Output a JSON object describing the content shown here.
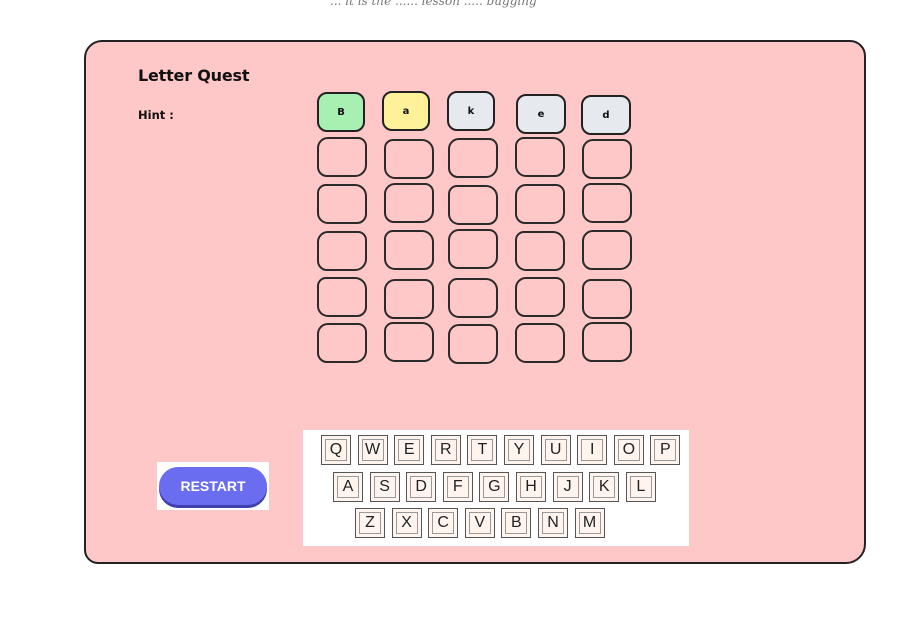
{
  "header": {
    "tagline": "... it is the ...... lesson ..... bugging"
  },
  "game": {
    "title": "Letter Quest",
    "hint_label": "Hint :",
    "hint_value": ""
  },
  "guess_row": [
    {
      "letter": "B",
      "status": "correct",
      "color": "#a8efb2"
    },
    {
      "letter": "a",
      "status": "present",
      "color": "#fff19a"
    },
    {
      "letter": "k",
      "status": "absent",
      "color": "#e6eaee"
    },
    {
      "letter": "e",
      "status": "absent",
      "color": "#e6eaee"
    },
    {
      "letter": "d",
      "status": "absent",
      "color": "#e6eaee"
    }
  ],
  "board": {
    "rows": 5,
    "cols": 5
  },
  "keyboard": {
    "row1": [
      "Q",
      "W",
      "E",
      "R",
      "T",
      "Y",
      "U",
      "I",
      "O",
      "P"
    ],
    "row2": [
      "A",
      "S",
      "D",
      "F",
      "G",
      "H",
      "J",
      "K",
      "L"
    ],
    "row3": [
      "Z",
      "X",
      "C",
      "V",
      "B",
      "N",
      "M"
    ]
  },
  "controls": {
    "restart_label": "RESTART"
  },
  "colors": {
    "card_bg": "#ffc8c8",
    "restart_bg": "#6a6df0",
    "key_bg": "#fff5ee"
  }
}
